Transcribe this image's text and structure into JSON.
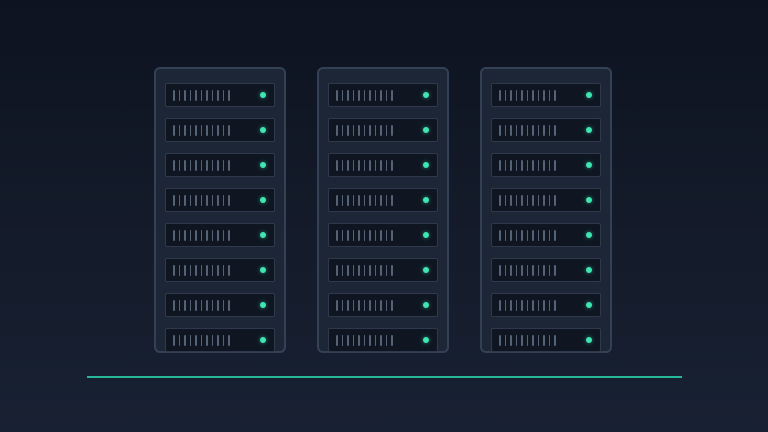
{
  "scene": {
    "racks": [
      {
        "id": "rack-1",
        "units": 8,
        "status": [
          "on",
          "on",
          "on",
          "on",
          "on",
          "on",
          "on",
          "on"
        ]
      },
      {
        "id": "rack-2",
        "units": 8,
        "status": [
          "on",
          "on",
          "on",
          "on",
          "on",
          "on",
          "on",
          "on"
        ]
      },
      {
        "id": "rack-3",
        "units": 8,
        "status": [
          "on",
          "on",
          "on",
          "on",
          "on",
          "on",
          "on",
          "on"
        ]
      }
    ],
    "vents_per_unit": 11,
    "colors": {
      "background_top": "#0d1320",
      "background_bottom": "#182133",
      "rack_body": "#1c2637",
      "rack_border": "#344154",
      "unit_body": "#0f1622",
      "vent": "#566276",
      "status_led": "#3fe6b2",
      "floor_line": "#27b898"
    },
    "icons": {
      "rack": "server-rack-icon",
      "led": "status-led-icon"
    }
  }
}
